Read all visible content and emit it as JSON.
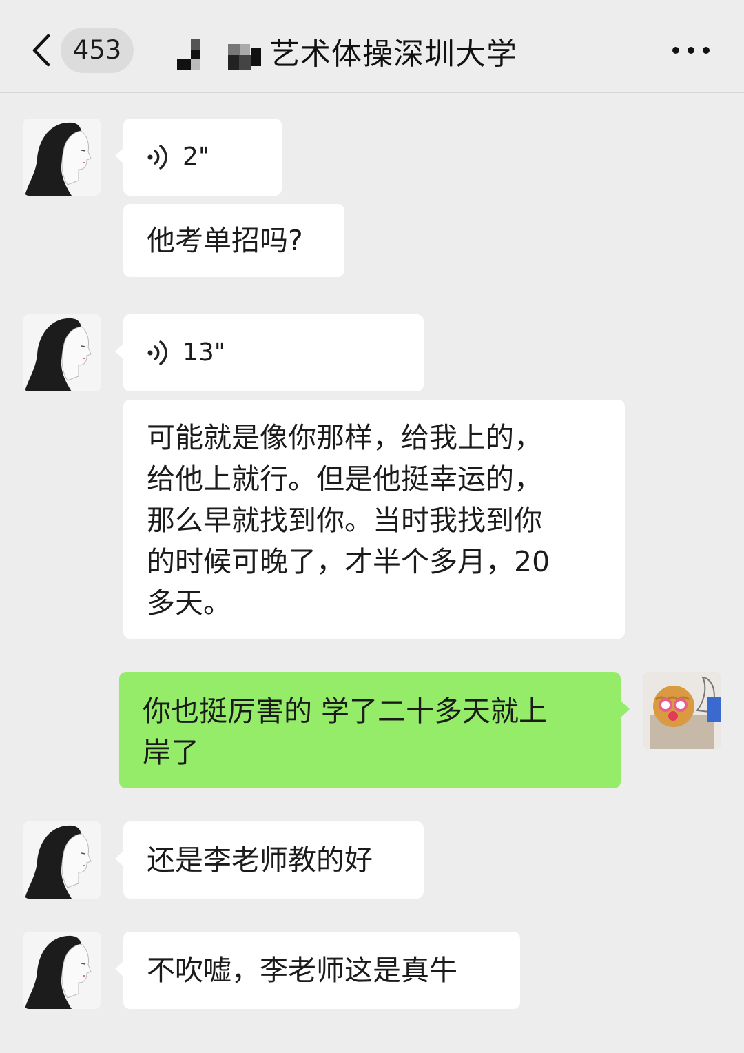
{
  "header": {
    "back_icon": "chevron-left-icon",
    "unread_count": "453",
    "title": "艺术体操深圳大学",
    "more_icon": "more-horizontal-icon"
  },
  "colors": {
    "background": "#ededed",
    "incoming_bubble": "#ffffff",
    "outgoing_bubble": "#95ec69"
  },
  "messages": [
    {
      "sender": "contact",
      "type": "voice",
      "duration": "2\"",
      "icon": "voice-wave-icon"
    },
    {
      "sender": "contact",
      "type": "text",
      "text": "他考单招吗?"
    },
    {
      "sender": "contact",
      "type": "voice",
      "duration": "13\"",
      "icon": "voice-wave-icon"
    },
    {
      "sender": "contact",
      "type": "text",
      "text": "可能就是像你那样，给我上的，\n给他上就行。但是他挺幸运的，\n那么早就找到你。当时我找到你\n的时候可晚了，才半个多月，20\n多天。"
    },
    {
      "sender": "me",
      "type": "text",
      "text": "你也挺厉害的 学了二十多天就上\n岸了"
    },
    {
      "sender": "contact",
      "type": "text",
      "text": "还是李老师教的好"
    },
    {
      "sender": "contact",
      "type": "text",
      "text": "不吹嘘，李老师这是真牛"
    }
  ]
}
